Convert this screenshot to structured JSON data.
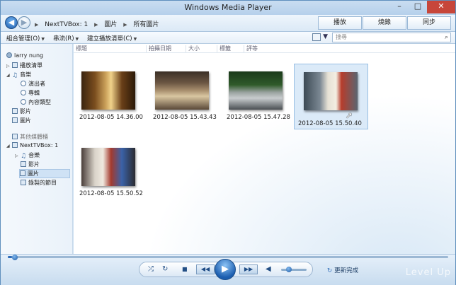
{
  "window": {
    "title": "Windows Media Player",
    "min_glyph": "–",
    "max_glyph": "□",
    "close_glyph": "✕"
  },
  "nav": {
    "back_glyph": "◀",
    "forward_glyph": "▶",
    "breadcrumb": [
      "NextTVBox: 1",
      "圖片",
      "所有圖片"
    ],
    "breadcrumb_sep": "▶"
  },
  "tabs": [
    "播放",
    "燒錄",
    "同步"
  ],
  "toolbar": {
    "organize": "組合管理(O)",
    "stream": "串流(R)",
    "create_playlist": "建立播放清單(C)",
    "search_placeholder": "搜尋",
    "search_icon": "magnifier-icon",
    "caret_glyph": "▼"
  },
  "sidebar": {
    "library_user": "larry nung",
    "items": [
      {
        "label": "播放清單",
        "icon": "playlist-icon"
      },
      {
        "label": "音樂",
        "icon": "music-note-icon"
      },
      {
        "label": "演出者",
        "icon": "artist-icon"
      },
      {
        "label": "專輯",
        "icon": "album-icon"
      },
      {
        "label": "內容類型",
        "icon": "genre-icon"
      },
      {
        "label": "影片",
        "icon": "video-icon"
      },
      {
        "label": "圖片",
        "icon": "picture-icon"
      }
    ],
    "other_libraries": "其他媒體櫃",
    "device": "NextTVBox: 1",
    "device_items": [
      {
        "label": "音樂",
        "icon": "music-note-icon"
      },
      {
        "label": "影片",
        "icon": "video-icon"
      },
      {
        "label": "圖片",
        "icon": "picture-icon",
        "selected": true
      },
      {
        "label": "錄製的節目",
        "icon": "recorded-tv-icon"
      }
    ]
  },
  "columns": [
    "標題",
    "拍攝日期",
    "大小",
    "標籤",
    "評等"
  ],
  "pictures": [
    {
      "caption": "2012-08-05 14.36.00"
    },
    {
      "caption": "2012-08-05 15.43.43"
    },
    {
      "caption": "2012-08-05 15.47.28"
    },
    {
      "caption": "2012-08-05 15.50.40",
      "selected": true
    },
    {
      "caption": "2012-08-05 15.50.52"
    }
  ],
  "player": {
    "shuffle_glyph": "⤮",
    "repeat_glyph": "↻",
    "stop_glyph": "■",
    "prev_glyph": "◀◀",
    "play_glyph": "▶",
    "next_glyph": "▶▶",
    "volume_glyph": "◀",
    "seek_progress": 0.01,
    "volume_level": 0.3,
    "update_label": "更新完成",
    "update_glyph": "↻"
  },
  "watermark": "Level Up",
  "colors": {
    "accent": "#1f5fae",
    "selection": "#dbeaf8",
    "close": "#c7463a"
  }
}
